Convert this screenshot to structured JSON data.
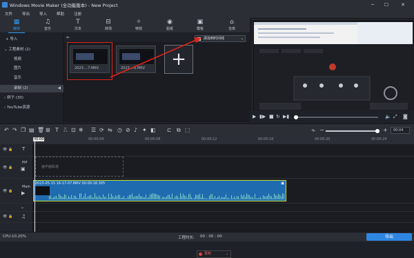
{
  "app": {
    "title": "Windows Movie Maker (全功能版本) - New Project"
  },
  "menu": [
    "文件",
    "导出",
    "导入",
    "帮助",
    "注册"
  ],
  "toolbar": {
    "items": [
      {
        "label": "媒体",
        "icon": "media-icon"
      },
      {
        "label": "音乐",
        "icon": "music-icon"
      },
      {
        "label": "文本",
        "icon": "text-icon"
      },
      {
        "label": "转场",
        "icon": "transition-icon"
      },
      {
        "label": "特效",
        "icon": "effects-icon"
      },
      {
        "label": "贴纸",
        "icon": "sticker-icon"
      },
      {
        "label": "模板",
        "icon": "template-icon"
      },
      {
        "label": "仓库",
        "icon": "store-icon"
      }
    ]
  },
  "sidebar": {
    "import": "导入",
    "project_group": "工程素材 (2)",
    "project_items": [
      "视频",
      "图片",
      "音乐",
      "录制 (2)"
    ],
    "example_group": "例子 (30)",
    "youtube": "YouTube资源"
  },
  "media": {
    "files": [
      {
        "name": "2023-...7.MKV"
      },
      {
        "name": "2023-...6.MKV"
      }
    ],
    "add_to_timeline": "添加到时间线",
    "add_tile_symbol": "+"
  },
  "preview": {
    "time": "00:04"
  },
  "timeline_toolbar": {
    "record_label": "录制"
  },
  "ruler": {
    "labels": [
      "00:00",
      "00:00:04",
      "00:00:08",
      "00:00:12",
      "00:00:16",
      "00:00:20",
      "00:00:24"
    ]
  },
  "tracks": {
    "text_symbol": "T",
    "pip_label": "PIP",
    "pip_placeholder": "画中画轨道",
    "main_label": "Main",
    "clip_title": "2023-05-15 16-17-07.MKV  00:00:18.305"
  },
  "status": {
    "cpu": "CPU:10.20%",
    "duration_label": "工程时长:",
    "duration_value": "00 : 00 : 00",
    "export": "导出"
  },
  "colors": {
    "accent": "#2f9cf3",
    "highlight": "#e2231a",
    "clip": "#1f6bb0",
    "clip_border": "#c7e03a"
  }
}
